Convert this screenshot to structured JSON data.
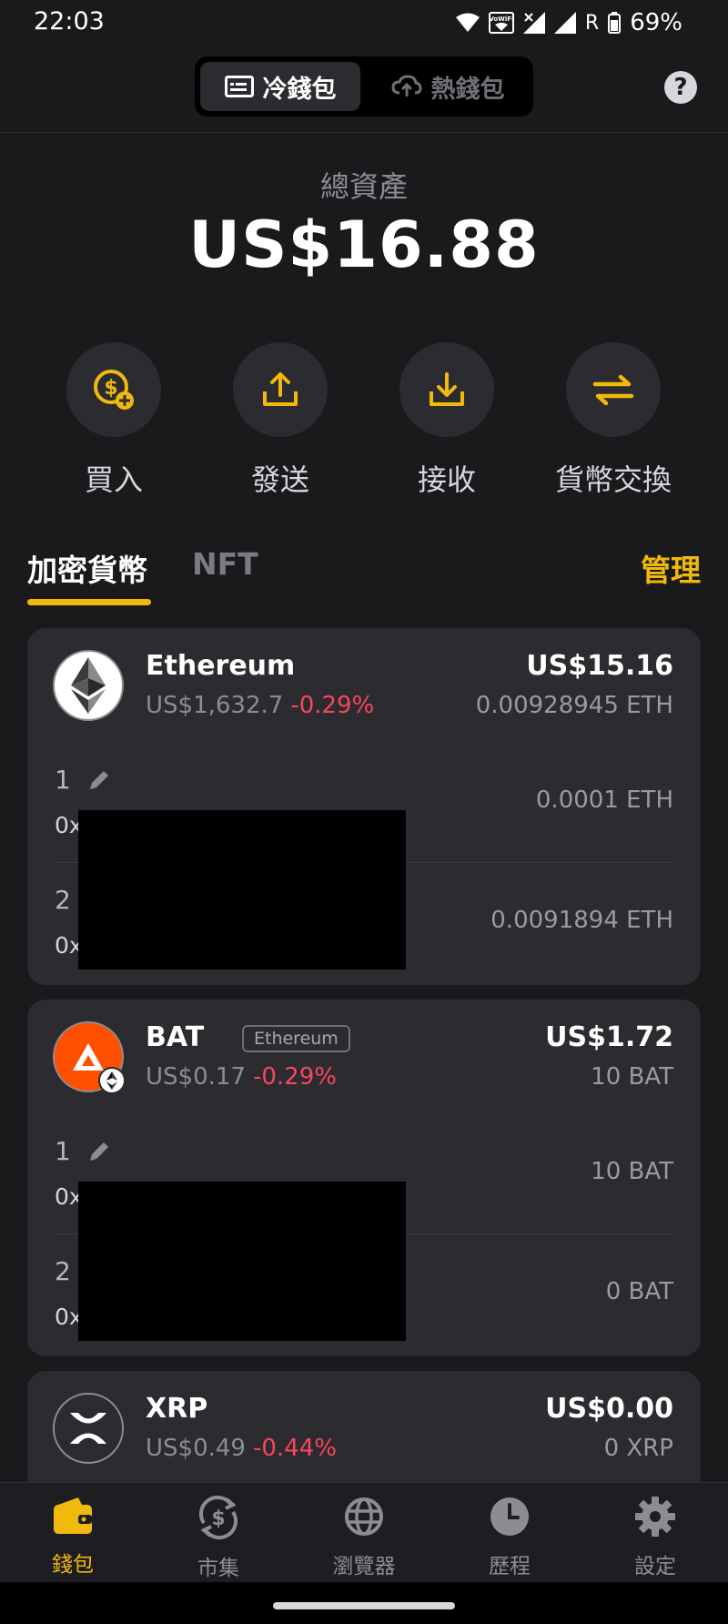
{
  "status_bar": {
    "time": "22:03",
    "battery": "69%",
    "carrier_indicator": "R",
    "wifi_call_badge": "VoWiFi"
  },
  "header": {
    "segments": [
      {
        "label": "冷錢包",
        "icon": "cold-wallet-card-icon",
        "active": true
      },
      {
        "label": "熱錢包",
        "icon": "cloud-icon",
        "active": false
      }
    ],
    "help_glyph": "?"
  },
  "balance": {
    "label": "總資產",
    "value": "US$16.88"
  },
  "actions": [
    {
      "label": "買入",
      "icon": "buy-dollar-plus-icon"
    },
    {
      "label": "發送",
      "icon": "upload-icon"
    },
    {
      "label": "接收",
      "icon": "download-icon"
    },
    {
      "label": "貨幣交換",
      "icon": "swap-arrows-icon"
    }
  ],
  "tabs": {
    "crypto": "加密貨幣",
    "nft": "NFT",
    "manage": "管理"
  },
  "assets": [
    {
      "name": "Ethereum",
      "price": "US$1,632.7",
      "change": "-0.29%",
      "usd": "US$15.16",
      "amount": "0.00928945 ETH",
      "accounts": [
        {
          "index": "1",
          "addr_prefix": "0x",
          "balance": "0.0001 ETH"
        },
        {
          "index": "2",
          "addr_prefix": "0x",
          "balance": "0.0091894 ETH"
        }
      ]
    },
    {
      "name": "BAT",
      "chain": "Ethereum",
      "price": "US$0.17",
      "change": "-0.29%",
      "usd": "US$1.72",
      "amount": "10 BAT",
      "accounts": [
        {
          "index": "1",
          "addr_prefix": "0x",
          "balance": "10 BAT"
        },
        {
          "index": "2",
          "addr_prefix": "0x",
          "balance": "0 BAT"
        }
      ]
    },
    {
      "name": "XRP",
      "price": "US$0.49",
      "change": "-0.44%",
      "usd": "US$0.00",
      "amount": "0 XRP"
    }
  ],
  "bottom_nav": [
    {
      "label": "錢包",
      "icon": "wallet-icon",
      "active": true
    },
    {
      "label": "市集",
      "icon": "market-dollar-cycle-icon",
      "active": false
    },
    {
      "label": "瀏覽器",
      "icon": "globe-icon",
      "active": false
    },
    {
      "label": "歷程",
      "icon": "clock-icon",
      "active": false
    },
    {
      "label": "設定",
      "icon": "settings-gear-icon",
      "active": false
    }
  ],
  "colors": {
    "accent": "#f0b90b",
    "negative": "#f6465d",
    "background": "#1a1a1d",
    "card": "#2b2b30"
  }
}
